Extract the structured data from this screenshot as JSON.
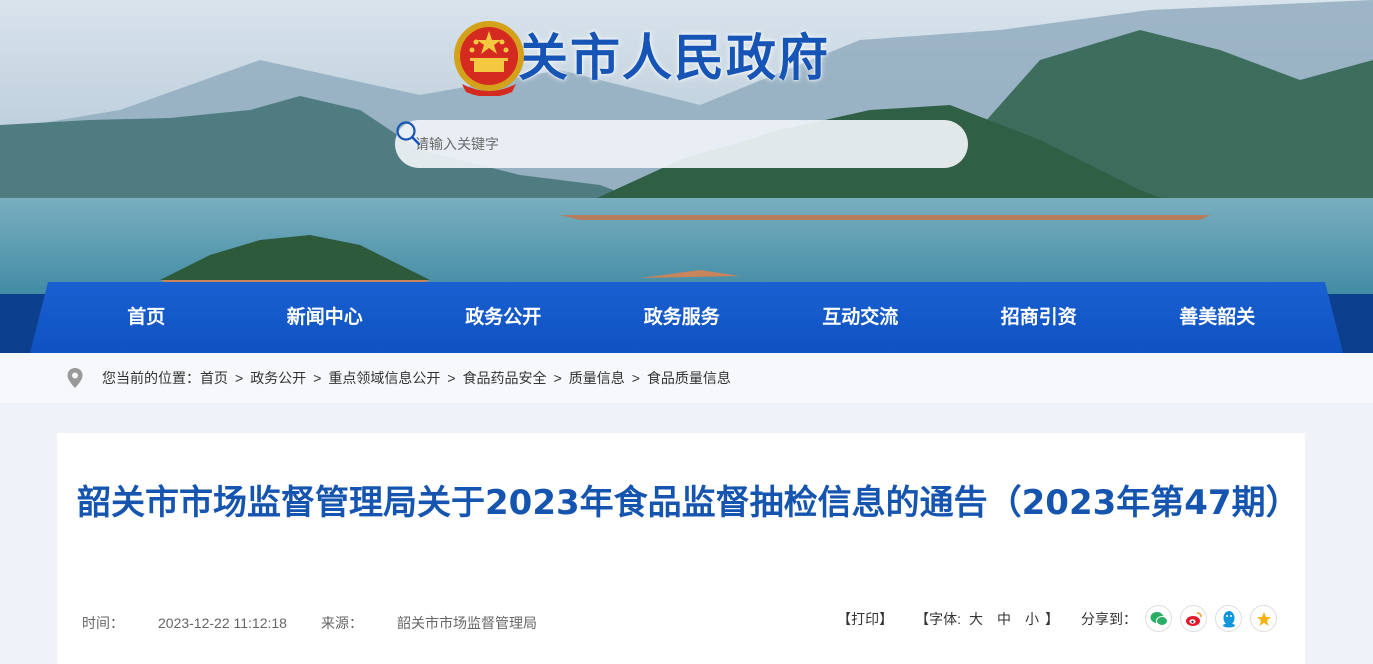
{
  "site": {
    "title": "韶关市人民政府",
    "emblem_icon": "national-emblem-icon",
    "brand_color": "#1654b6"
  },
  "search": {
    "placeholder": "请输入关键字",
    "icon": "search-icon"
  },
  "nav": {
    "items": [
      {
        "label": "首页"
      },
      {
        "label": "新闻中心"
      },
      {
        "label": "政务公开",
        "active": true
      },
      {
        "label": "政务服务"
      },
      {
        "label": "互动交流"
      },
      {
        "label": "招商引资"
      },
      {
        "label": "善美韶关"
      }
    ],
    "color": "#0f52c1"
  },
  "breadcrumb": {
    "icon": "location-pin-icon",
    "prefix": "您当前的位置：",
    "items": [
      "首页",
      "政务公开",
      "重点领域信息公开",
      "食品药品安全",
      "质量信息",
      "食品质量信息"
    ],
    "separator": ">"
  },
  "article": {
    "title": "韶关市市场监督管理局关于2023年食品监督抽检信息的通告（2023年第47期）",
    "time_label": "时间：",
    "time": "2023-12-22 11:12:18",
    "source_label": "来源：",
    "source": "韶关市市场监督管理局",
    "title_color": "#1555b0"
  },
  "tools": {
    "print": "【打印】",
    "font_label": "【字体:",
    "font_large": "大",
    "font_medium": "中",
    "font_small": "小",
    "font_close": "】",
    "share_label": "分享到：",
    "share_icons": [
      "wechat-icon",
      "weibo-icon",
      "qq-icon",
      "qzone-icon"
    ]
  }
}
